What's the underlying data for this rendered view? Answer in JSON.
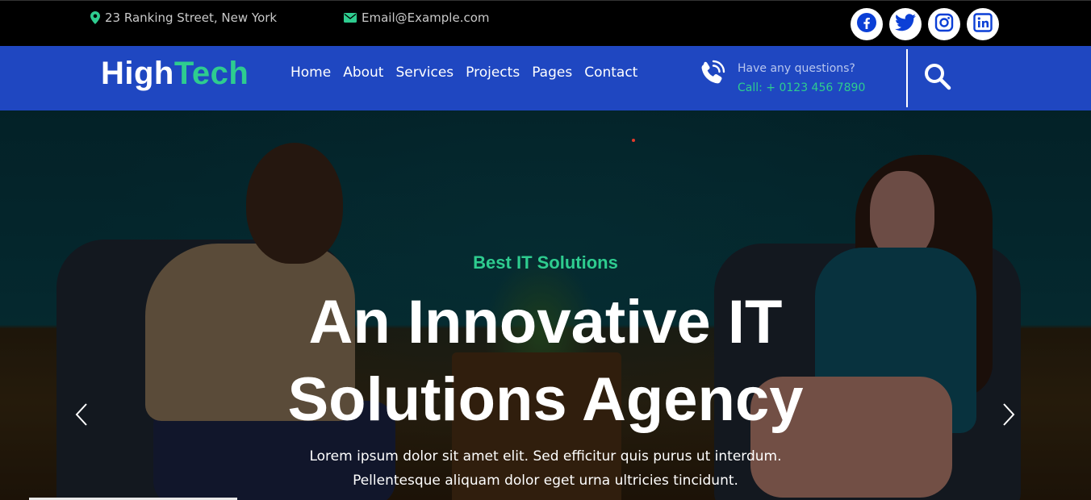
{
  "topbar": {
    "address": "23 Ranking Street, New York",
    "email": "Email@Example.com",
    "socials": [
      "facebook-icon",
      "twitter-icon",
      "instagram-icon",
      "linkedin-icon"
    ]
  },
  "navbar": {
    "brand_part1": "High",
    "brand_part2": "Tech",
    "menu": [
      "Home",
      "About",
      "Services",
      "Projects",
      "Pages",
      "Contact"
    ],
    "contact_question": "Have any questions?",
    "contact_phone": "Call: + 0123 456 7890"
  },
  "hero": {
    "tagline": "Best IT Solutions",
    "headline_line1": "An Innovative IT",
    "headline_line2": "Solutions Agency",
    "subtext_line1": "Lorem ipsum dolor sit amet elit. Sed efficitur quis purus ut interdum.",
    "subtext_line2": "Pellentesque aliquam dolor eget urna ultricies tincidunt."
  },
  "colors": {
    "topbar_bg": "#000000",
    "navbar_bg": "#1f47c1",
    "accent_green": "#2ecc8f",
    "white": "#ffffff"
  }
}
